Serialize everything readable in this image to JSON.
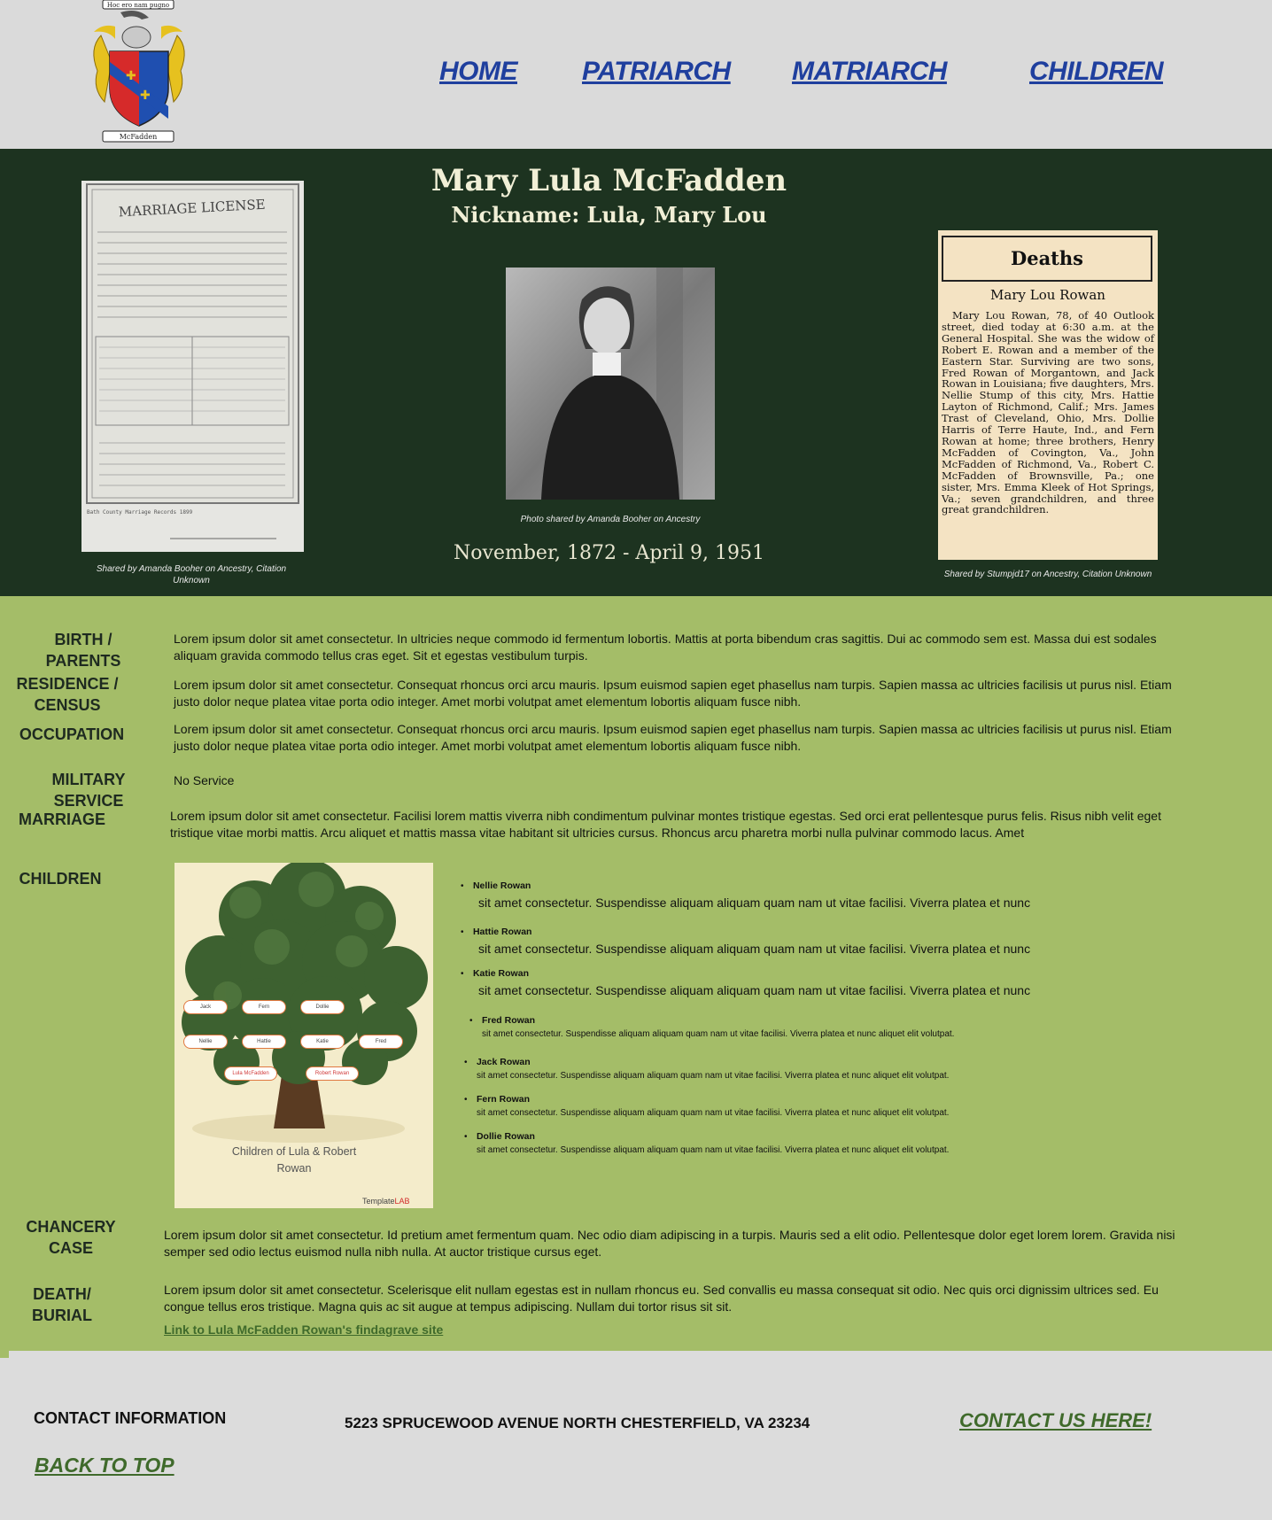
{
  "nav": {
    "home": "HOME",
    "patriarch": "PATRIARCH",
    "matriarch": "MATRIARCH",
    "children": "CHILDREN"
  },
  "crest": {
    "motto": "Hoc ero nam pugno",
    "name": "McFadden"
  },
  "hero": {
    "name": "Mary Lula McFadden",
    "nickname": "Nickname:  Lula, Mary Lou",
    "dates": "November, 1872 - April 9, 1951",
    "license_caption": "Shared by Amanda Booher on Ancestry, Citation Unknown",
    "photo_caption": "Photo shared by Amanda Booher on Ancestry",
    "obit_caption": "Shared by Stumpjd17 on Ancestry, Citation Unknown",
    "license_title": "MARRIAGE LICENSE",
    "license_footer": "Bath County Marriage Records 1899",
    "obit_heading": "Deaths",
    "obit_name": "Mary Lou Rowan",
    "obit_text": "Mary Lou Rowan, 78, of 40 Outlook street, died today at 6:30 a.m. at the General Hospital. She was the widow of Robert E. Rowan and a member of the Eastern Star. Surviving are two sons, Fred Rowan of Morgantown, and Jack Rowan in Louisiana; five daughters, Mrs. Nellie Stump of this city, Mrs. Hattie Layton of Richmond, Calif.; Mrs. James Trast of Cleveland, Ohio, Mrs. Dollie Harris of Terre Haute, Ind., and Fern Rowan at home; three brothers, Henry McFadden of Covington, Va., John McFadden of Richmond, Va., Robert C. McFadden of Brownsville, Pa.; one sister, Mrs. Emma Kleek of Hot Springs, Va.; seven grandchildren, and three great grandchildren."
  },
  "sections": {
    "birth_label": "BIRTH / PARENTS",
    "birth_text": "Lorem ipsum dolor sit amet consectetur. In ultricies neque commodo id fermentum lobortis. Mattis at porta bibendum cras sagittis. Dui ac commodo sem est. Massa dui est sodales aliquam gravida commodo tellus cras eget. Sit et egestas vestibulum turpis.",
    "residence_label_1": "RESIDENCE /",
    "residence_label_2": "CENSUS",
    "residence_text": "Lorem ipsum dolor sit amet consectetur. Consequat rhoncus orci arcu mauris. Ipsum euismod sapien eget phasellus nam turpis. Sapien massa ac ultricies facilisis ut purus nisl. Etiam justo dolor neque platea vitae porta odio integer. Amet morbi volutpat amet elementum lobortis aliquam fusce nibh.",
    "occupation_label": "OCCUPATION",
    "occupation_text": "Lorem ipsum dolor sit amet consectetur. Consequat rhoncus orci arcu mauris. Ipsum euismod sapien eget phasellus nam turpis. Sapien massa ac ultricies facilisis ut purus nisl. Etiam justo dolor neque platea vitae porta odio integer. Amet morbi volutpat amet elementum lobortis aliquam fusce nibh.",
    "military_label": "MILITARY SERVICE",
    "military_text": "No Service",
    "marriage_label": "MARRIAGE",
    "marriage_text": "Lorem ipsum dolor sit amet consectetur. Facilisi lorem mattis viverra nibh condimentum pulvinar montes tristique egestas. Sed orci erat pellentesque purus felis. Risus nibh velit eget tristique vitae morbi mattis. Arcu aliquet et mattis massa vitae habitant sit ultricies cursus. Rhoncus arcu pharetra morbi nulla pulvinar commodo lacus. Amet",
    "children_label": "CHILDREN",
    "chancery_label_1": "CHANCERY",
    "chancery_label_2": "CASE",
    "chancery_text": "Lorem ipsum dolor sit amet consectetur. Id pretium amet fermentum quam. Nec odio diam adipiscing in a turpis. Mauris sed a elit odio. Pellentesque dolor eget lorem lorem. Gravida nisi semper sed odio lectus euismod nulla nibh nulla. At auctor tristique cursus eget.",
    "death_label_1": "DEATH/",
    "death_label_2": "BURIAL",
    "death_text": "Lorem ipsum dolor sit amet consectetur. Scelerisque elit nullam egestas est in nullam rhoncus eu. Sed convallis eu massa consequat sit odio. Nec quis orci dignissim ultrices sed. Eu congue tellus eros tristique. Magna quis ac sit augue at tempus adipiscing. Nullam dui tortor risus sit sit.",
    "findagrave_link": "Link to Lula McFadden Rowan's findagrave site"
  },
  "tree": {
    "caption_1": "Children of Lula & Robert",
    "caption_2": "Rowan",
    "brand_small": "Template",
    "brand_red": "LAB",
    "pills_row1": [
      "Jack",
      "Fern",
      "Dollie"
    ],
    "pills_row2": [
      "Nellie",
      "Hattie",
      "Katie",
      "Fred"
    ],
    "parent_left": "Lula McFadden",
    "parent_right": "Robert Rowan"
  },
  "children": [
    {
      "name": "Nellie Rowan",
      "text": "sit amet consectetur. Suspendisse aliquam aliquam quam nam ut vitae facilisi. Viverra platea et nunc"
    },
    {
      "name": "Hattie Rowan",
      "text": "sit amet consectetur. Suspendisse aliquam aliquam quam nam ut vitae facilisi. Viverra platea et nunc"
    },
    {
      "name": "Katie Rowan",
      "text": "sit amet consectetur. Suspendisse aliquam aliquam quam nam ut vitae facilisi. Viverra platea et nunc"
    },
    {
      "name": "Fred Rowan",
      "text": "sit amet consectetur. Suspendisse aliquam aliquam quam nam ut vitae facilisi. Viverra platea et nunc aliquet elit volutpat."
    },
    {
      "name": "Jack Rowan",
      "text": "sit amet consectetur. Suspendisse aliquam aliquam quam nam ut vitae facilisi. Viverra platea et nunc aliquet elit volutpat."
    },
    {
      "name": "Fern Rowan",
      "text": "sit amet consectetur. Suspendisse aliquam aliquam quam nam ut vitae facilisi. Viverra platea et nunc aliquet elit volutpat."
    },
    {
      "name": "Dollie Rowan",
      "text": "sit amet consectetur. Suspendisse aliquam aliquam quam nam ut vitae facilisi. Viverra platea et nunc aliquet elit volutpat."
    }
  ],
  "footer": {
    "contact_label": "CONTACT INFORMATION",
    "address": "5223 SPRUCEWOOD AVENUE NORTH CHESTERFIELD, VA 23234",
    "contact_link": "CONTACT US HERE!",
    "back_to_top": "BACK TO TOP"
  },
  "colors": {
    "hero_bg": "#1d3320",
    "content_bg": "#a4bd68",
    "nav_link": "#1f3f9e",
    "footer_link": "#3f6a2b",
    "header_bg": "#dadada"
  }
}
